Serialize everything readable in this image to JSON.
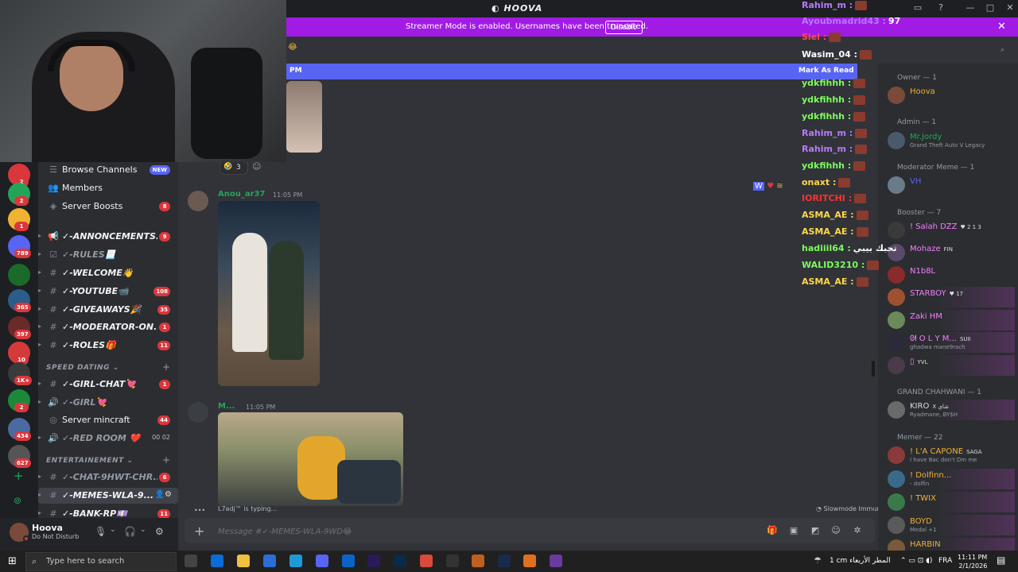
{
  "app": {
    "title": "HOOVA"
  },
  "banner": {
    "text": "Streamer Mode is enabled. Usernames have been truncated.",
    "button": "Disable"
  },
  "unread": {
    "time": "PM",
    "mark_read": "Mark As Read"
  },
  "channels": [
    {
      "name": "Browse Channels",
      "glyph": "☰",
      "badge": "NEW",
      "plain": true
    },
    {
      "name": "Members",
      "glyph": "👥",
      "plain": true
    },
    {
      "name": "Server Boosts",
      "glyph": "◈",
      "badge": "8",
      "plain": true
    },
    {
      "name": "✓-ANNONCEMENTS...",
      "glyph": "📢",
      "badge": "9"
    },
    {
      "name": "✓-RULES📃",
      "glyph": "☑",
      "dim": true
    },
    {
      "name": "✓-WELCOME👋",
      "glyph": "#"
    },
    {
      "name": "✓-YOUTUBE📹",
      "glyph": "#",
      "badge": "108"
    },
    {
      "name": "✓-GIVEAWAYS🎉",
      "glyph": "#",
      "badge": "35"
    },
    {
      "name": "✓-MODERATOR-ON...",
      "glyph": "#",
      "badge": "1"
    },
    {
      "name": "✓-ROLES🎁",
      "glyph": "#",
      "badge": "11"
    },
    {
      "name": "✓-GIRL-CHAT💘",
      "glyph": "#",
      "badge": "1"
    },
    {
      "name": "✓-GIRL💘",
      "glyph": "🔊",
      "dim": true
    },
    {
      "name": "Server mincraft",
      "glyph": "◎",
      "badge": "44",
      "plain": true
    },
    {
      "name": "✓-RED ROOM ❤️",
      "glyph": "🔊",
      "dim": true,
      "extra": "00  02"
    },
    {
      "name": "✓-CHAT-9HWT-CHR...",
      "glyph": "#",
      "badge": "6",
      "dim": true
    },
    {
      "name": "✓-MEMES-WLA-9...",
      "glyph": "#"
    },
    {
      "name": "✓-BANK-RP💷",
      "glyph": "#",
      "badge": "11"
    }
  ],
  "categories": {
    "speed_dating": "SPEED DATING",
    "entertainement": "ENTERTAINEMENT"
  },
  "rail_badges": [
    "2",
    "2",
    "1",
    "789",
    "365",
    "397",
    "10",
    "1K+",
    "2",
    "434",
    "627"
  ],
  "user": {
    "name": "Hoova",
    "status": "Do Not Disturb"
  },
  "chat": {
    "reaction_count": "3",
    "msg1": {
      "author": "Anou_ar37",
      "time": "11:05 PM"
    },
    "msg2": {
      "author": "M...",
      "time": "11:05 PM"
    },
    "typing": "L7adj™ is typing...",
    "slowmode": "Slowmode Immune",
    "composer_placeholder": "Message #✓-MEMES-WLA-9WD😂"
  },
  "stream_chat": [
    {
      "user": "Rahim_m :",
      "color": "#b57bff",
      "emote": true
    },
    {
      "user": "Ayoubmadrid43 :",
      "color": "#b57bff",
      "text": "97"
    },
    {
      "user": "Siel :",
      "color": "#ff4a4a",
      "emote": true
    },
    {
      "user": "Wasim_04 :",
      "color": "#ffffff",
      "emote": true
    },
    {
      "user": "",
      "color": "#ffffff",
      "emote": false
    },
    {
      "user": "ydkfihhh :",
      "color": "#7cfc5c",
      "emote": true
    },
    {
      "user": "ydkfihhh :",
      "color": "#7cfc5c",
      "emote": true
    },
    {
      "user": "ydkfihhh :",
      "color": "#7cfc5c",
      "emote": true
    },
    {
      "user": "Rahim_m :",
      "color": "#b57bff",
      "emote": true
    },
    {
      "user": "Rahim_m :",
      "color": "#b57bff",
      "emote": true
    },
    {
      "user": "ydkfihhh :",
      "color": "#7cfc5c",
      "emote": true
    },
    {
      "user": "onaxt :",
      "color": "#ffd84a",
      "emote": true
    },
    {
      "user": "IORITCHI :",
      "color": "#ff3030",
      "emote": true
    },
    {
      "user": "ASMA_AE :",
      "color": "#ffd84a",
      "emote": true
    },
    {
      "user": "ASMA_AE :",
      "color": "#ffd84a",
      "emote": true
    },
    {
      "user": "hadiiil64 :",
      "color": "#7cfc5c",
      "text": "تحبك بيبي"
    },
    {
      "user": "WALID3210 :",
      "color": "#7cfc5c",
      "emote": true
    },
    {
      "user": "ASMA_AE :",
      "color": "#ffd84a",
      "emote": true
    }
  ],
  "members": {
    "roles": [
      "Owner — 1",
      "Admin — 1",
      "Moderator Meme — 1",
      "Booster — 7",
      "GRAND CHAHWANI — 1",
      "Memer — 22"
    ],
    "list": [
      {
        "name": "Hoova",
        "color": "#f0b232"
      },
      {
        "name": "Mr.Jordy",
        "color": "#23a559",
        "sub": "Grand Theft Auto V Legacy"
      },
      {
        "name": "VH",
        "color": "#5865f2"
      },
      {
        "name": "! Salah DZZ",
        "color": "#f47fff",
        "tag": "♥ 2 1 3"
      },
      {
        "name": "Mohaze",
        "color": "#f47fff",
        "tag": "FIN"
      },
      {
        "name": "N1b8L",
        "color": "#f47fff"
      },
      {
        "name": "STARBOY",
        "color": "#f47fff",
        "tag": "♥ 17"
      },
      {
        "name": "Zaki HM",
        "color": "#f47fff"
      },
      {
        "name": "ᘛ O L Y M...",
        "color": "#f47fff",
        "tag": "SUII",
        "sub": "ghadwa mane9rach"
      },
      {
        "name": "▯",
        "color": "#f47fff",
        "tag": "YVL"
      },
      {
        "name": "KIRO",
        "color": "#dbdee1",
        "tag": "X شاي",
        "sub": "Ryadmane, BY$H"
      },
      {
        "name": "! L'A CAPONE",
        "color": "#f0b232",
        "tag": "SAGA",
        "sub": "I have Bac don't Dm me"
      },
      {
        "name": "! Dolfinn...",
        "color": "#f0b232",
        "sub": "- dolfin"
      },
      {
        "name": "! TWIX",
        "color": "#f0b232"
      },
      {
        "name": "BOYD",
        "color": "#f0b232",
        "sub": "Medal +1"
      },
      {
        "name": "HARBIN",
        "color": "#f0b232"
      }
    ]
  },
  "taskbar": {
    "search": "Type here to search",
    "weather": "1 cm  المطر الأربعاء",
    "time": "11:11 PM",
    "date": "2/1/2026",
    "lang": "FRA"
  }
}
